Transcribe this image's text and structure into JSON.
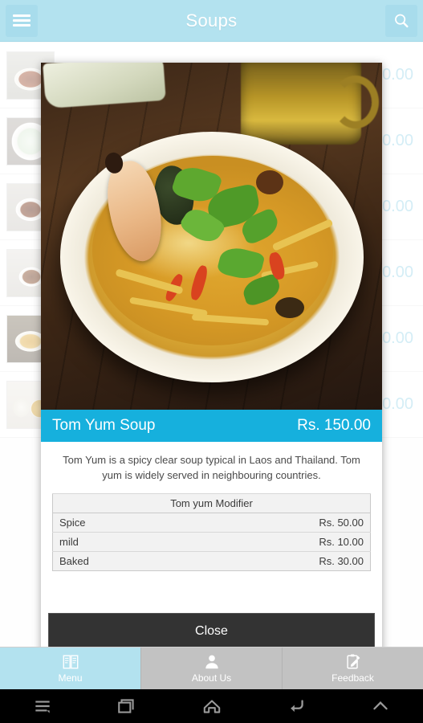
{
  "header": {
    "title": "Soups",
    "menu_icon": "hamburger-menu-icon",
    "search_icon": "search-icon"
  },
  "list": {
    "rows": [
      {
        "name": "",
        "price": "0.00"
      },
      {
        "name": "",
        "price": "0.00"
      },
      {
        "name": "",
        "price": "0.00"
      },
      {
        "name": "",
        "price": "0.00"
      },
      {
        "name": "",
        "price": "0.00"
      },
      {
        "name": "",
        "price": "0.00"
      }
    ]
  },
  "modal": {
    "image_alt": "tom-yum-soup-photo",
    "title": "Tom Yum Soup",
    "price": "Rs. 150.00",
    "description": "Tom Yum is a spicy clear soup typical in Laos and Thailand. Tom yum is widely served in neighbouring countries.",
    "modifier_table": {
      "header": "Tom yum Modifier",
      "rows": [
        {
          "label": "Spice",
          "price": "Rs. 50.00"
        },
        {
          "label": "mild",
          "price": "Rs. 10.00"
        },
        {
          "label": "Baked",
          "price": "Rs. 30.00"
        }
      ]
    },
    "close_label": "Close"
  },
  "tabbar": {
    "tabs": [
      {
        "label": "Menu",
        "icon": "book-menu-icon",
        "active": true
      },
      {
        "label": "About Us",
        "icon": "person-icon",
        "active": false
      },
      {
        "label": "Feedback",
        "icon": "clipboard-pencil-icon",
        "active": false
      }
    ]
  },
  "navbar": {
    "buttons": [
      {
        "icon": "menu-icon"
      },
      {
        "icon": "recents-icon"
      },
      {
        "icon": "home-icon"
      },
      {
        "icon": "back-icon"
      },
      {
        "icon": "chevron-up-icon"
      }
    ]
  },
  "colors": {
    "header_bg": "#b3e2ef",
    "modal_accent": "#16b0dd",
    "price_text": "#9fd8ea",
    "close_bg": "#333333",
    "tab_inactive": "#c2c2c2"
  }
}
